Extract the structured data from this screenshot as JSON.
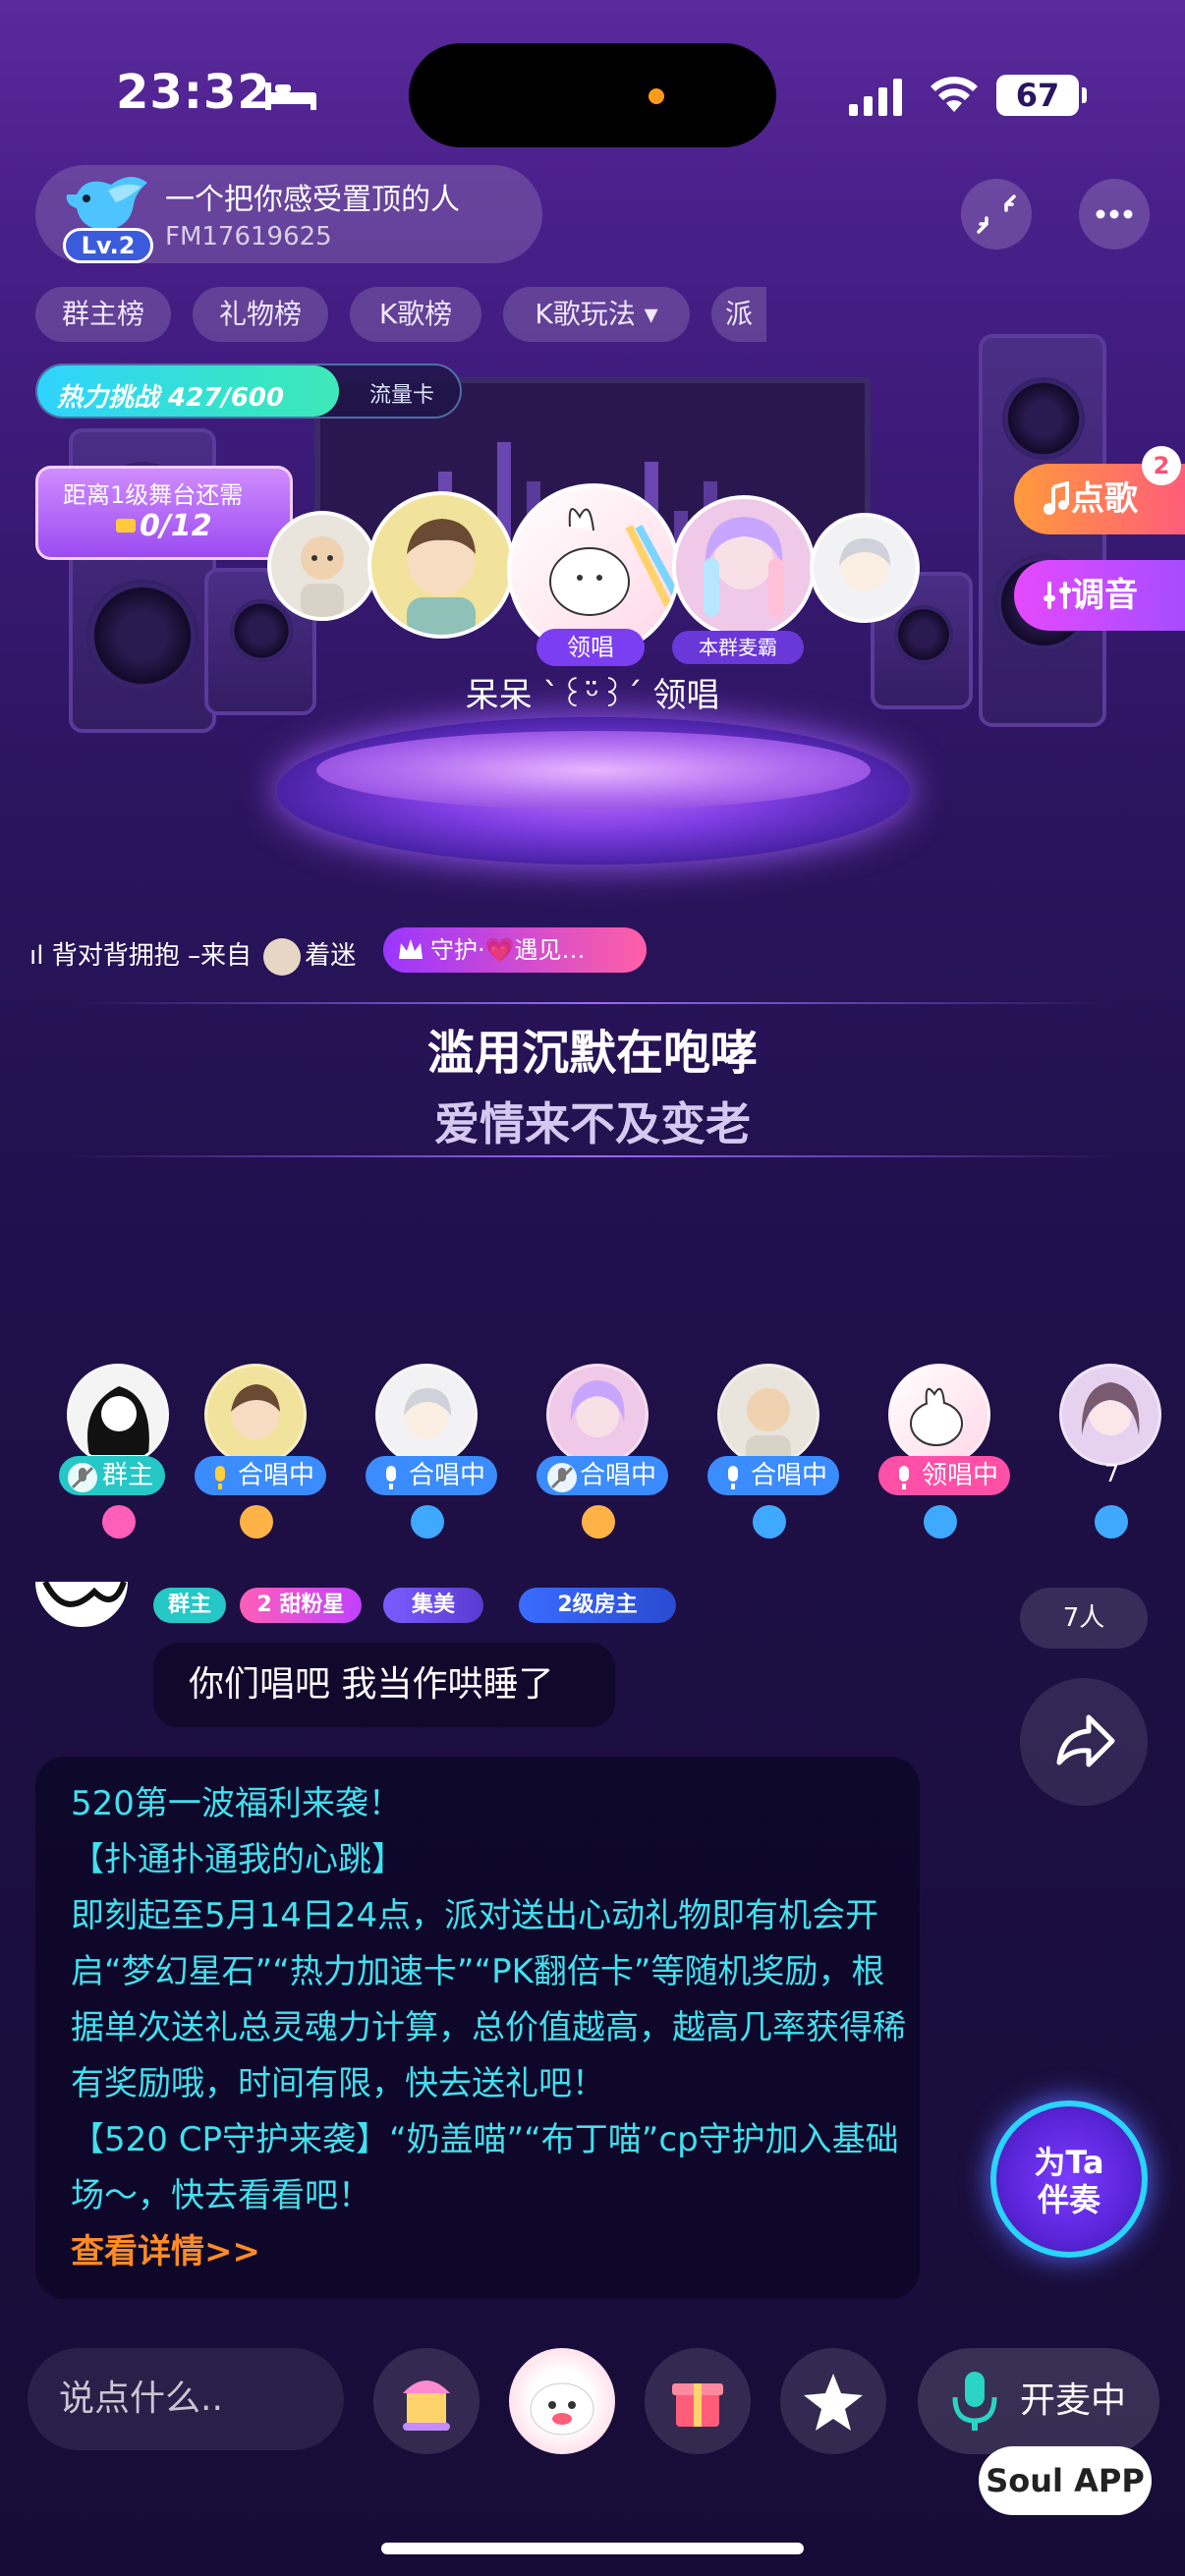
{
  "status": {
    "time": "23:32",
    "battery": "67"
  },
  "room": {
    "title": "一个把你感受置顶的人",
    "id": "FM17619625",
    "level": "Lv.2"
  },
  "tabs": [
    "群主榜",
    "礼物榜",
    "K歌榜",
    "K歌玩法 ▾",
    "派"
  ],
  "heat": {
    "label": "热力挑战 427/600",
    "card": "流量卡",
    "progress": 0.71
  },
  "stage_goal": {
    "title": "距离1级舞台还需",
    "value": "0/12"
  },
  "stage": {
    "lead_tag": "领唱",
    "mic_king": "本群麦霸",
    "singer_name": "呆呆 ˋ꒰ᵕ̈꒱ˊ 领唱"
  },
  "side_buttons": {
    "order": "点歌",
    "order_badge": "2",
    "tune": "调音"
  },
  "now_playing": {
    "song": "背对背拥抱 –来自",
    "from_user": "着迷",
    "guard_badge": "守护·💗遇见…"
  },
  "lyrics": {
    "current": "滥用沉默在咆哮",
    "next": "爱情来不及变老"
  },
  "seats": [
    {
      "tag": "群主"
    },
    {
      "tag": "合唱中"
    },
    {
      "tag": "合唱中"
    },
    {
      "tag": "合唱中"
    },
    {
      "tag": "合唱中"
    },
    {
      "tag": "领唱中"
    },
    {
      "tag": "7"
    }
  ],
  "chat": {
    "badges": [
      "群主",
      "2 甜粉星",
      "集美",
      "2级房主"
    ],
    "message": "你们唱吧 我当作哄睡了",
    "people": "7人"
  },
  "notice": {
    "lines": [
      "520第一波福利来袭！",
      "【扑通扑通我的心跳】",
      "即刻起至5月14日24点，派对送出心动礼物即有机会开启“梦幻星石”“热力加速卡”“PK翻倍卡”等随机奖励，根据单次送礼总灵魂力计算，总价值越高，越高几率获得稀有奖励哦，时间有限，快去送礼吧！",
      "【520 CP守护来袭】“奶盖喵”“布丁喵”cp守护加入基础场～，快去看看吧！"
    ],
    "link": "查看详情>>"
  },
  "accompany": {
    "line1": "为Ta",
    "line2": "伴奏"
  },
  "bottom": {
    "say_placeholder": "说点什么..",
    "mic_label": "开麦中",
    "brand": "Soul APP"
  },
  "colors": {
    "notice_text": "#41e0ee",
    "link": "#ff8a26",
    "accent_purple": "#9b4cf0"
  }
}
